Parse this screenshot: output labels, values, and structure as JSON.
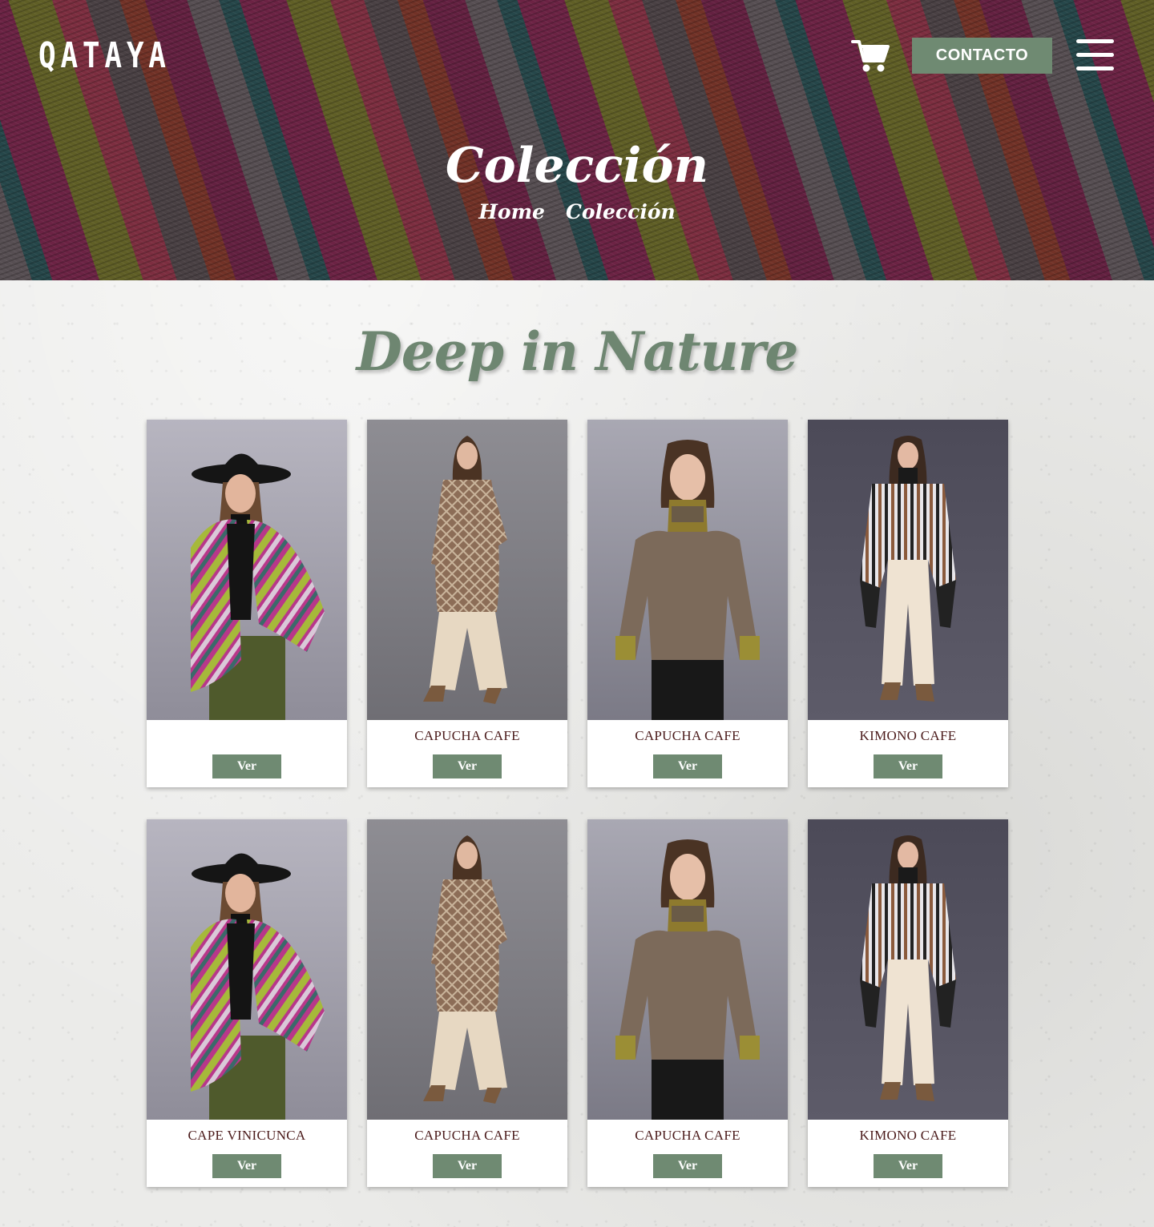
{
  "header": {
    "logo": "QATAYA",
    "cart_icon": "cart-icon",
    "contact_label": "CONTACTO",
    "menu_icon": "hamburger-menu-icon"
  },
  "hero": {
    "title": "Colección",
    "breadcrumb": [
      "Home",
      "Colección"
    ]
  },
  "section": {
    "title": "Deep in Nature"
  },
  "products": [
    {
      "name": "",
      "button": "Ver",
      "style": "cape"
    },
    {
      "name": "CAPUCHA CAFE",
      "button": "Ver",
      "style": "coat"
    },
    {
      "name": "CAPUCHA CAFE",
      "button": "Ver",
      "style": "sweater"
    },
    {
      "name": "KIMONO CAFE",
      "button": "Ver",
      "style": "kimono"
    },
    {
      "name": "CAPE VINICUNCA",
      "button": "Ver",
      "style": "cape"
    },
    {
      "name": "CAPUCHA CAFE",
      "button": "Ver",
      "style": "coat"
    },
    {
      "name": "CAPUCHA CAFE",
      "button": "Ver",
      "style": "sweater"
    },
    {
      "name": "KIMONO CAFE",
      "button": "Ver",
      "style": "kimono"
    }
  ],
  "colors": {
    "accent_green": "#6f8a72",
    "title_green": "#6e8671",
    "product_name": "#4b1b1b"
  }
}
